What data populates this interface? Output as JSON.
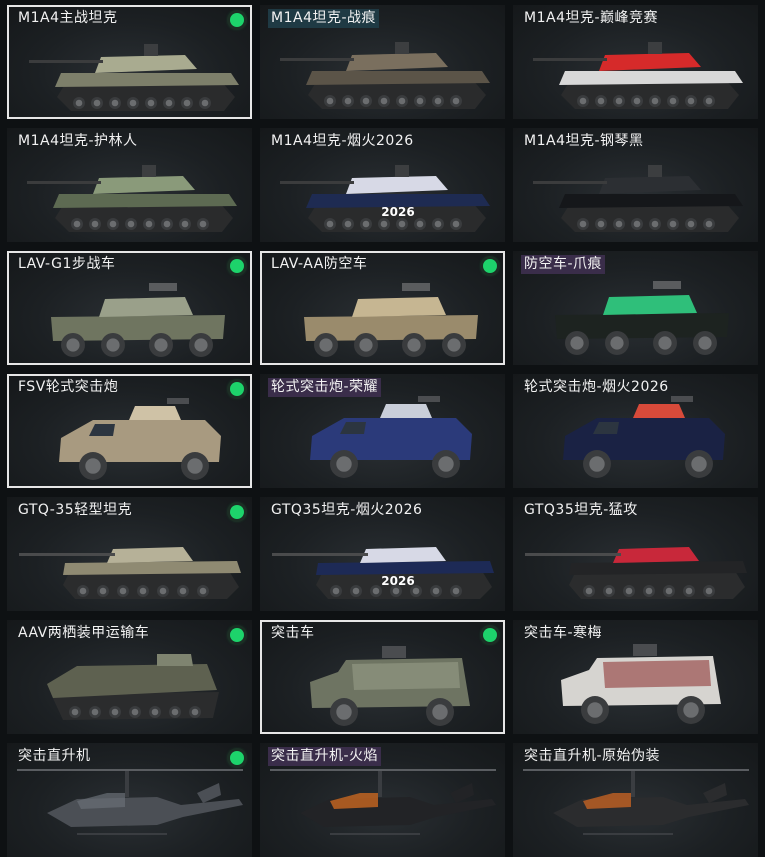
{
  "cards": [
    {
      "label": "M1A4主战坦克",
      "selected": true,
      "equipped": true,
      "tag": "none",
      "kind": "tank",
      "hull": "#7d7f6a",
      "accent": "#a9ab90"
    },
    {
      "label": "M1A4坦克-战痕",
      "selected": false,
      "equipped": false,
      "tag": "blue",
      "kind": "tank",
      "hull": "#5b5448",
      "accent": "#7a6f5e"
    },
    {
      "label": "M1A4坦克-巅峰竞赛",
      "selected": false,
      "equipped": false,
      "tag": "none",
      "kind": "tank",
      "hull": "#d8d8d8",
      "accent": "#d62a2a"
    },
    {
      "label": "M1A4坦克-护林人",
      "selected": false,
      "equipped": false,
      "tag": "none",
      "kind": "tank",
      "hull": "#5d6a52",
      "accent": "#8a9a7a"
    },
    {
      "label": "M1A4坦克-烟火2026",
      "selected": false,
      "equipped": false,
      "tag": "none",
      "kind": "tank",
      "hull": "#1e2b52",
      "accent": "#d7d9e6",
      "badge": "2026"
    },
    {
      "label": "M1A4坦克-钢琴黑",
      "selected": false,
      "equipped": false,
      "tag": "none",
      "kind": "tank",
      "hull": "#15171a",
      "accent": "#2c2f33"
    },
    {
      "label": "LAV-G1步战车",
      "selected": true,
      "equipped": true,
      "tag": "none",
      "kind": "apc",
      "hull": "#6f7560",
      "accent": "#9aa08a"
    },
    {
      "label": "LAV-AA防空车",
      "selected": true,
      "equipped": true,
      "tag": "none",
      "kind": "apc",
      "hull": "#9a8b6c",
      "accent": "#c6b692"
    },
    {
      "label": "防空车-爪痕",
      "selected": false,
      "equipped": false,
      "tag": "purple",
      "kind": "apc",
      "hull": "#1d2320",
      "accent": "#2fbf7a"
    },
    {
      "label": "FSV轮式突击炮",
      "selected": true,
      "equipped": true,
      "tag": "none",
      "kind": "fsv",
      "hull": "#a89a80",
      "accent": "#cfc2a6"
    },
    {
      "label": "轮式突击炮-荣耀",
      "selected": false,
      "equipped": false,
      "tag": "purple",
      "kind": "fsv",
      "hull": "#2b3a7a",
      "accent": "#c9ced9"
    },
    {
      "label": "轮式突击炮-烟火2026",
      "selected": false,
      "equipped": false,
      "tag": "none",
      "kind": "fsv",
      "hull": "#1a2244",
      "accent": "#d84a3a"
    },
    {
      "label": "GTQ-35轻型坦克",
      "selected": false,
      "equipped": true,
      "tag": "none",
      "kind": "light",
      "hull": "#8f8a72",
      "accent": "#b6b198"
    },
    {
      "label": "GTQ35坦克-烟火2026",
      "selected": false,
      "equipped": false,
      "tag": "none",
      "kind": "light",
      "hull": "#1d2a56",
      "accent": "#d7d9e6",
      "badge": "2026"
    },
    {
      "label": "GTQ35坦克-猛攻",
      "selected": false,
      "equipped": false,
      "tag": "none",
      "kind": "light",
      "hull": "#232426",
      "accent": "#c8283a"
    },
    {
      "label": "AAV两栖装甲运输车",
      "selected": false,
      "equipped": true,
      "tag": "none",
      "kind": "aav",
      "hull": "#5e6150",
      "accent": "#7f8470"
    },
    {
      "label": "突击车",
      "selected": true,
      "equipped": true,
      "tag": "none",
      "kind": "mrap",
      "hull": "#6e7462",
      "accent": "#9aa08b"
    },
    {
      "label": "突击车-寒梅",
      "selected": false,
      "equipped": false,
      "tag": "none",
      "kind": "mrap",
      "hull": "#d6d4d0",
      "accent": "#8a2a2a"
    },
    {
      "label": "突击直升机",
      "selected": false,
      "equipped": true,
      "tag": "none",
      "kind": "heli",
      "hull": "#4b4f55",
      "accent": "#6a6f76"
    },
    {
      "label": "突击直升机-火焰",
      "selected": false,
      "equipped": false,
      "tag": "purple",
      "kind": "heli",
      "hull": "#222326",
      "accent": "#e07020"
    },
    {
      "label": "突击直升机-原始伪装",
      "selected": false,
      "equipped": false,
      "tag": "none",
      "kind": "heli",
      "hull": "#2b2c2e",
      "accent": "#d86a22"
    }
  ],
  "icons": {
    "equipped": "green-dot-icon"
  }
}
